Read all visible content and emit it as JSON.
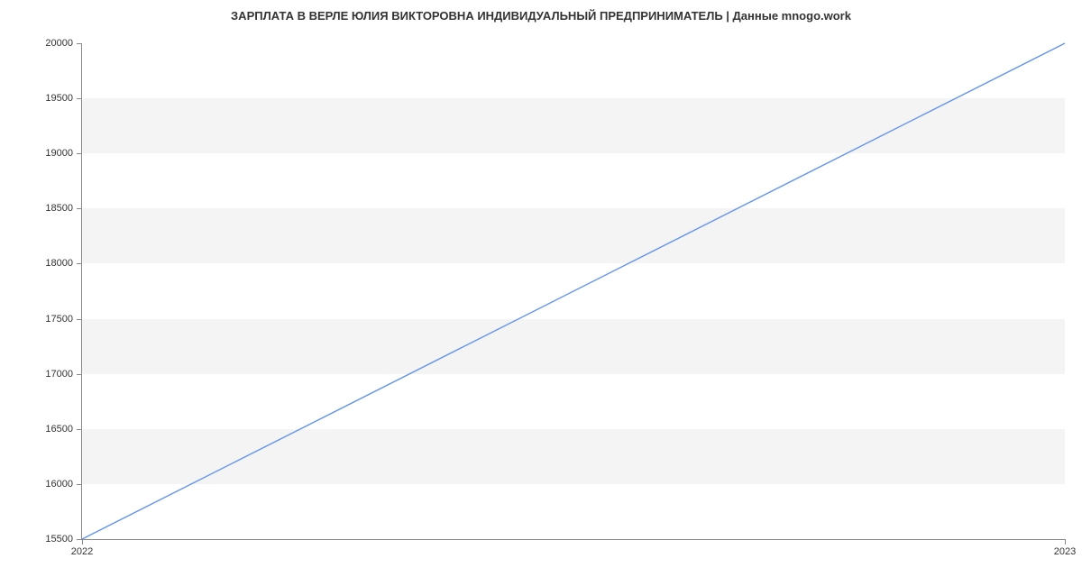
{
  "chart_data": {
    "type": "line",
    "title": "ЗАРПЛАТА В ВЕРЛЕ ЮЛИЯ ВИКТОРОВНА ИНДИВИДУАЛЬНЫЙ ПРЕДПРИНИМАТЕЛЬ | Данные mnogo.work",
    "xlabel": "",
    "ylabel": "",
    "x": [
      "2022",
      "2023"
    ],
    "y_ticks": [
      15500,
      16000,
      16500,
      17000,
      17500,
      18000,
      18500,
      19000,
      19500,
      20000
    ],
    "ylim": [
      15500,
      20000
    ],
    "series": [
      {
        "name": "salary",
        "values": [
          15500,
          20000
        ],
        "color": "#6495ed"
      }
    ]
  }
}
